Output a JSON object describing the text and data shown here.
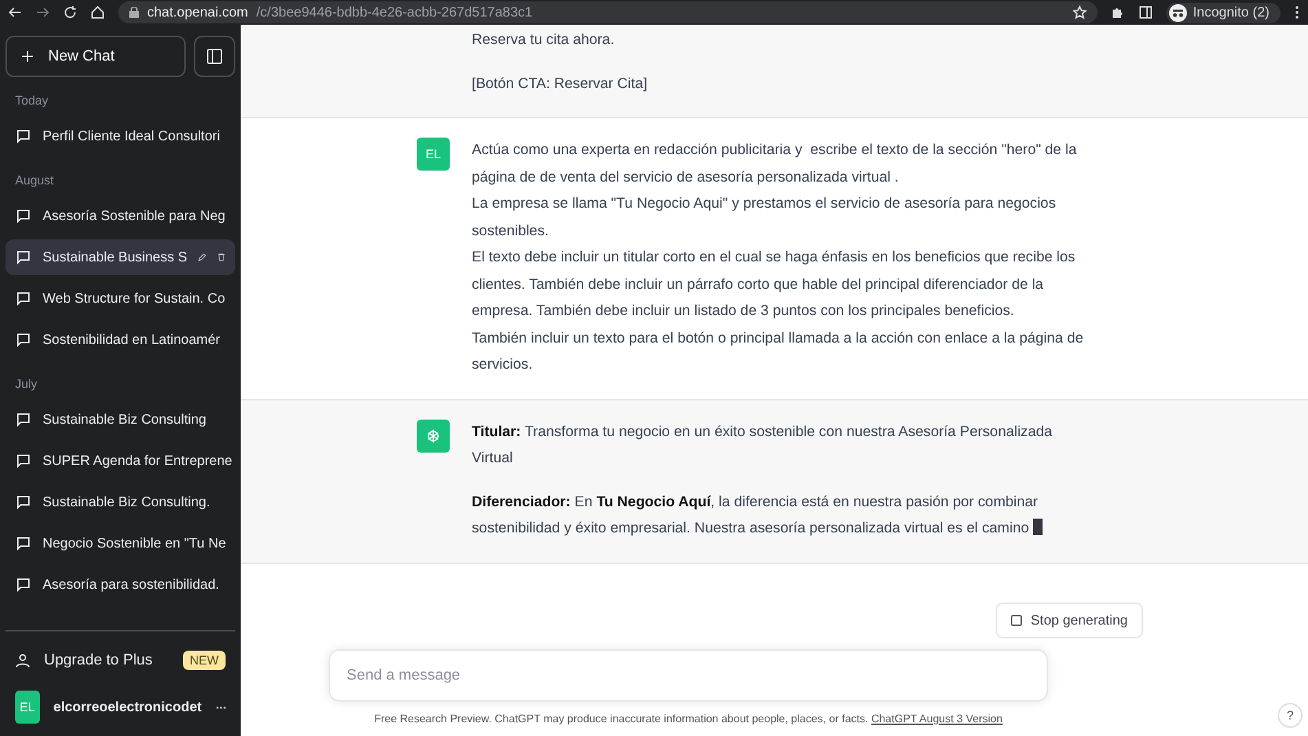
{
  "browser": {
    "url_host": "chat.openai.com",
    "url_path": "/c/3bee9446-bdbb-4e26-acbb-267d517a83c1",
    "profile": "Incognito (2)"
  },
  "sidebar": {
    "new_chat": "New Chat",
    "groups": [
      {
        "label": "Today",
        "items": [
          {
            "title": "Perfil Cliente Ideal Consultori",
            "selected": false
          }
        ]
      },
      {
        "label": "August",
        "items": [
          {
            "title": "Asesoría Sostenible para Neg",
            "selected": false
          },
          {
            "title": "Sustainable Business S",
            "selected": true
          },
          {
            "title": "Web Structure for Sustain. Co",
            "selected": false
          },
          {
            "title": "Sostenibilidad en Latinoamér",
            "selected": false
          }
        ]
      },
      {
        "label": "July",
        "items": [
          {
            "title": "Sustainable Biz Consulting",
            "selected": false
          },
          {
            "title": "SUPER Agenda for Entreprene",
            "selected": false
          },
          {
            "title": "Sustainable Biz Consulting.",
            "selected": false
          },
          {
            "title": "Negocio Sostenible en \"Tu Ne",
            "selected": false
          },
          {
            "title": "Asesoría para sostenibilidad.",
            "selected": false
          }
        ]
      }
    ],
    "upgrade": {
      "label": "Upgrade to Plus",
      "badge": "NEW"
    },
    "user": {
      "initials": "EL",
      "name": "elcorreoelectronicodet"
    }
  },
  "messages": [
    {
      "kind": "assistant",
      "paragraphs": [
        "Reserva tu cita ahora.",
        "[Botón CTA: Reservar Cita]"
      ]
    },
    {
      "kind": "user",
      "avatar": "EL",
      "paragraphs": [
        "Actúa como una experta en redacción publicitaria y  escribe el texto de la sección \"hero\" de la página de de venta del servicio de asesoría personalizada virtual .\nLa empresa se llama \"Tu Negocio Aqui\" y prestamos el servicio de asesoría para negocios sostenibles.\nEl texto debe incluir un titular corto en el cual se haga énfasis en los beneficios que recibe los clientes. También debe incluir un párrafo corto que hable del principal diferenciador de la empresa. También debe incluir un listado de 3 puntos con los principales beneficios.\nTambién incluir un texto para el botón o principal llamada a la acción con enlace a la página de servicios."
      ]
    },
    {
      "kind": "assistant",
      "streaming": true,
      "paragraphs": [
        "**Titular:** Transforma tu negocio en un éxito sostenible con nuestra Asesoría Personalizada Virtual",
        "**Diferenciador:** En **Tu Negocio Aquí**, la diferencia está en nuestra pasión por combinar sostenibilidad y éxito empresarial. Nuestra asesoría personalizada virtual es el camino"
      ]
    }
  ],
  "stop_button": "Stop generating",
  "composer": {
    "placeholder": "Send a message"
  },
  "footer": {
    "text": "Free Research Preview. ChatGPT may produce inaccurate information about people, places, or facts.",
    "link": "ChatGPT August 3 Version"
  },
  "help": "?"
}
